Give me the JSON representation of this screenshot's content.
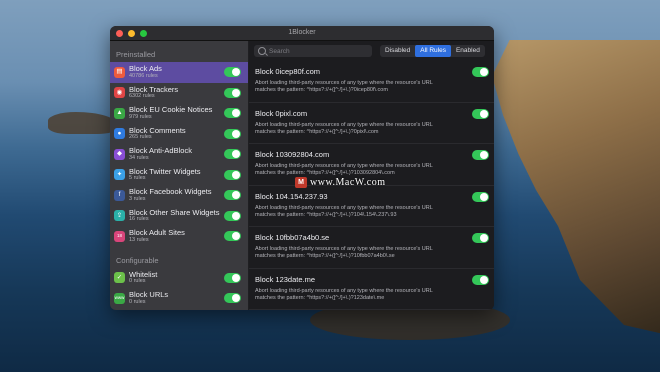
{
  "window": {
    "title": "1Blocker"
  },
  "sidebar": {
    "preinstalled_label": "Preinstalled",
    "configurable_label": "Configurable",
    "items": [
      {
        "name": "Block Ads",
        "rules": "40786 rules",
        "icon": "ads-icon",
        "color": "#ef5b3e",
        "glyph": "▤",
        "selected": true
      },
      {
        "name": "Block Trackers",
        "rules": "6302 rules",
        "icon": "tracker-icon",
        "color": "#e04545",
        "glyph": "◉"
      },
      {
        "name": "Block EU Cookie Notices",
        "rules": "979 rules",
        "icon": "cookie-icon",
        "color": "#3aa845",
        "glyph": "▲"
      },
      {
        "name": "Block Comments",
        "rules": "265 rules",
        "icon": "comment-icon",
        "color": "#2f7be0",
        "glyph": "●"
      },
      {
        "name": "Block Anti-AdBlock",
        "rules": "34 rules",
        "icon": "antiadblock-icon",
        "color": "#8a4ed6",
        "glyph": "◆"
      },
      {
        "name": "Block Twitter Widgets",
        "rules": "5 rules",
        "icon": "twitter-icon",
        "color": "#3ba0e6",
        "glyph": "✦"
      },
      {
        "name": "Block Facebook Widgets",
        "rules": "3 rules",
        "icon": "facebook-icon",
        "color": "#3b5998",
        "glyph": "f"
      },
      {
        "name": "Block Other Share Widgets",
        "rules": "16 rules",
        "icon": "share-icon",
        "color": "#2ab0a8",
        "glyph": "⇪"
      },
      {
        "name": "Block Adult Sites",
        "rules": "13 rules",
        "icon": "adult-icon",
        "color": "#d8457a",
        "glyph": "18"
      }
    ],
    "configurable_items": [
      {
        "name": "Whitelist",
        "rules": "0 rules",
        "icon": "whitelist-icon",
        "color": "#6cc04a",
        "glyph": "✓"
      },
      {
        "name": "Block URLs",
        "rules": "0 rules",
        "icon": "url-icon",
        "color": "#3aa845",
        "glyph": "www"
      }
    ]
  },
  "toolbar": {
    "search_placeholder": "Search",
    "filters": [
      "Disabled",
      "All Rules",
      "Enabled"
    ],
    "active_filter": "All Rules"
  },
  "rules": [
    {
      "title": "Block 0icep80f.com",
      "desc_line1": "Abort loading third-party resources of any type where the resource's URL",
      "desc_line2": "matches the pattern: ^https?://+([^:/]+\\.)?0icep80f\\.com"
    },
    {
      "title": "Block 0pixl.com",
      "desc_line1": "Abort loading third-party resources of any type where the resource's URL",
      "desc_line2": "matches the pattern: ^https?://+([^:/]+\\.)?0pixl\\.com"
    },
    {
      "title": "Block 103092804.com",
      "desc_line1": "Abort loading third-party resources of any type where the resource's URL",
      "desc_line2": "matches the pattern: ^https?://+([^:/]+\\.)?103092804\\.com"
    },
    {
      "title": "Block 104.154.237.93",
      "desc_line1": "Abort loading third-party resources of any type where the resource's URL",
      "desc_line2": "matches the pattern: ^https?://+([^:/]+\\.)?104\\.154\\.237\\.93"
    },
    {
      "title": "Block 10fbb07a4b0.se",
      "desc_line1": "Abort loading third-party resources of any type where the resource's URL",
      "desc_line2": "matches the pattern: ^https?://+([^:/]+\\.)?10fbb07a4b0\\.se"
    },
    {
      "title": "Block 123date.me",
      "desc_line1": "Abort loading third-party resources of any type where the resource's URL",
      "desc_line2": "matches the pattern: ^https?://+([^:/]+\\.)?123date\\.me"
    }
  ],
  "watermark": {
    "text": "www.MacW.com",
    "logo_letter": "M"
  }
}
